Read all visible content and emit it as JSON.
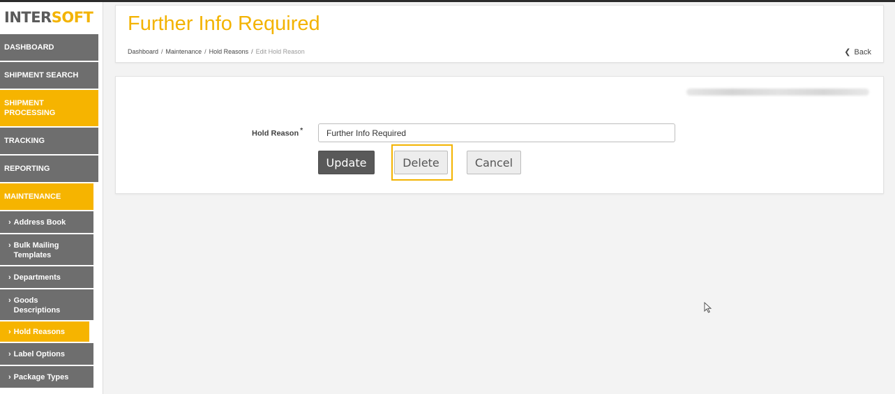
{
  "brand": {
    "logo_main": "INTER",
    "logo_accent": "SOFT",
    "accent_color": "#f3b300",
    "nav_bg_color": "#6e6e6e"
  },
  "sidebar": {
    "nav": [
      {
        "label": "DASHBOARD",
        "active": false
      },
      {
        "label": "SHIPMENT SEARCH",
        "active": false
      },
      {
        "label": "SHIPMENT PROCESSING",
        "active": true
      },
      {
        "label": "TRACKING",
        "active": false
      },
      {
        "label": "REPORTING",
        "active": false
      },
      {
        "label": "MAINTENANCE",
        "active": true
      }
    ],
    "chevron": "›",
    "maintenance_items": [
      {
        "label": "Address Book",
        "active": false
      },
      {
        "label": "Bulk Mailing Templates",
        "active": false
      },
      {
        "label": "Departments",
        "active": false
      },
      {
        "label": "Goods Descriptions",
        "active": false
      },
      {
        "label": "Hold Reasons",
        "active": true
      },
      {
        "label": "Label Options",
        "active": false
      },
      {
        "label": "Package Types",
        "active": false
      }
    ]
  },
  "header": {
    "title": "Further Info Required",
    "breadcrumb": [
      "Dashboard",
      "Maintenance",
      "Hold Reasons",
      "Edit Hold Reason"
    ],
    "breadcrumb_separator": "/",
    "back_label": "Back"
  },
  "form": {
    "hold_reason_label": "Hold Reason",
    "required_marker": "*",
    "hold_reason_value": "Further Info Required",
    "update_label": "Update",
    "delete_label": "Delete",
    "cancel_label": "Cancel"
  }
}
